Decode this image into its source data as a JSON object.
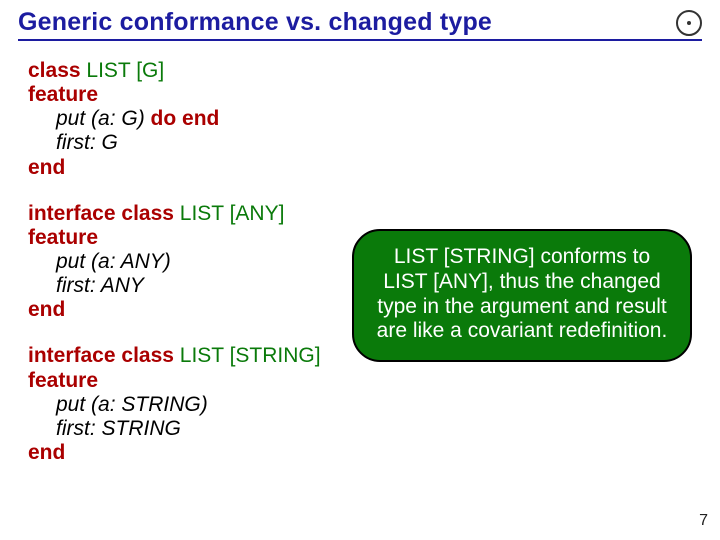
{
  "slide": {
    "title": "Generic conformance vs. changed type",
    "page_number": "7"
  },
  "code1": {
    "l1_kw": "class",
    "l1_gen": " LIST [G]",
    "l2_kw": "feature",
    "l3_it": "put (a: G) ",
    "l3_kw1": "do",
    "l3_sp": " ",
    "l3_kw2": "end",
    "l4_it": "first: G",
    "l5_kw": "end"
  },
  "code2": {
    "l1_kw1": "interface",
    "l1_sp": " ",
    "l1_kw2": "class",
    "l1_gen": " LIST [ANY]",
    "l2_kw": "feature",
    "l3_it": "put (a: ANY)",
    "l4_it": "first: ANY",
    "l5_kw": "end"
  },
  "code3": {
    "l1_kw1": "interface",
    "l1_sp": " ",
    "l1_kw2": "class",
    "l1_gen": " LIST [STRING]",
    "l2_kw": "feature",
    "l3_it": "put (a: STRING)",
    "l4_it": "first: STRING",
    "l5_kw": "end"
  },
  "callout": {
    "text": "LIST [STRING] conforms to LIST [ANY], thus the changed type in the argument and result are like a covariant redefinition."
  }
}
